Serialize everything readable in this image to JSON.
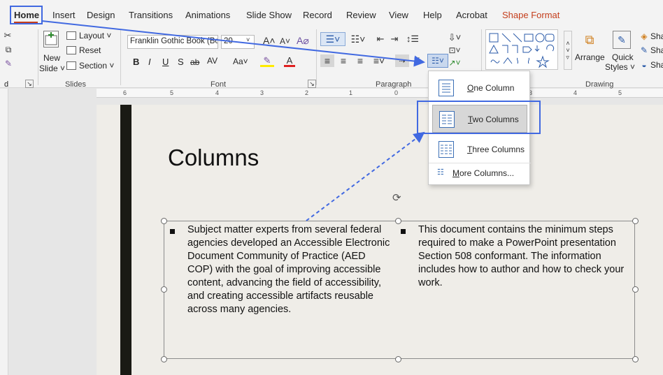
{
  "menubar": {
    "tabs": [
      {
        "label": "Home"
      },
      {
        "label": "Insert"
      },
      {
        "label": "Design"
      },
      {
        "label": "Transitions"
      },
      {
        "label": "Animations"
      },
      {
        "label": "Slide Show"
      },
      {
        "label": "Record"
      },
      {
        "label": "Review"
      },
      {
        "label": "View"
      },
      {
        "label": "Help"
      },
      {
        "label": "Acrobat"
      },
      {
        "label": "Shape Format"
      }
    ]
  },
  "ribbon": {
    "slides_group": {
      "new_slide": "New",
      "new_slide_line2": "Slide ˅",
      "layout": "Layout ˅",
      "reset": "Reset",
      "section": "Section ˅",
      "label": "Slides"
    },
    "font_group": {
      "font_name": "Franklin Gothic Book (Bod",
      "font_size": "20",
      "label": "Font",
      "bold": "B",
      "italic": "I",
      "underline": "U",
      "shadow": "S",
      "strike": "ab",
      "spacing": "AV",
      "case": "Aa˅"
    },
    "paragraph_group": {
      "label": "Paragraph"
    },
    "drawing_group": {
      "arrange": "Arrange",
      "quick_styles_1": "Quick",
      "quick_styles_2": "Styles ˅",
      "shape_1": "Sha",
      "shape_2": "Sha",
      "shape_3": "Sha",
      "label": "Drawing"
    },
    "left_fragments": {
      "d": "d"
    }
  },
  "ruler": {
    "ticks": [
      "6",
      "5",
      "4",
      "3",
      "2",
      "1",
      "0",
      "3",
      "4",
      "5"
    ]
  },
  "slide": {
    "title": "Columns",
    "column1": "Subject matter experts from several federal agencies developed an Accessible Electronic Document Community of Practice (AED COP) with the goal of improving accessible content, advancing the field of accessibility, and creating accessible artifacts reusable across many agencies.",
    "column2": "This document contains the minimum steps required to make a PowerPoint presentation Section 508 conformant. The information includes how to author and how to check your work."
  },
  "columns_menu": {
    "items": [
      {
        "label": "One Column",
        "underline_char": "O",
        "rest": "ne Column"
      },
      {
        "label": "Two Columns",
        "underline_char": "T",
        "rest": "wo Columns"
      },
      {
        "label": "Three Columns",
        "underline_char": "T",
        "rest": "hree Columns"
      }
    ],
    "more": "More Columns...",
    "more_underline": "M",
    "more_rest": "ore Columns..."
  },
  "colors": {
    "accent_red": "#c43e1c",
    "highlight_blue": "#4169e1",
    "slide_bg": "#efede8",
    "slide_bar": "#1a1a14"
  }
}
